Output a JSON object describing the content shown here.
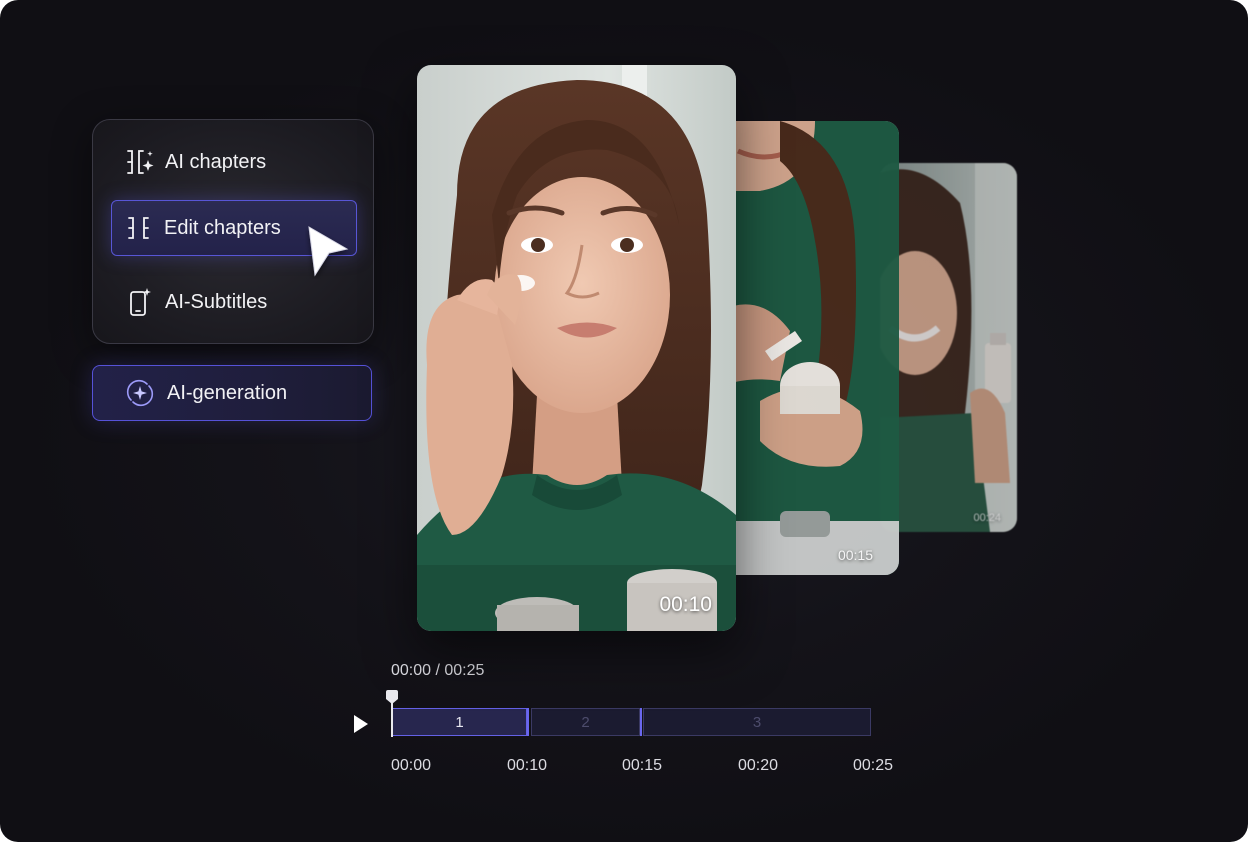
{
  "menu": {
    "items": [
      {
        "label": "AI chapters",
        "icon": "ai-chapters-icon"
      },
      {
        "label": "Edit chapters",
        "icon": "chapter-brackets-icon",
        "selected": true
      },
      {
        "label": "AI-Subtitles",
        "icon": "phone-sparkle-icon"
      }
    ]
  },
  "generation_button": {
    "label": "AI-generation",
    "icon": "sparkle-orbit-icon"
  },
  "cards": [
    {
      "timestamp": "00:10"
    },
    {
      "timestamp": "00:15"
    },
    {
      "timestamp": "00:24"
    }
  ],
  "timeline": {
    "readout": "00:00 / 00:25",
    "segments": [
      {
        "label": "1",
        "active": true
      },
      {
        "label": "2",
        "active": false
      },
      {
        "label": "3",
        "active": false
      }
    ],
    "tick_labels": [
      "00:00",
      "00:10",
      "00:15",
      "00:20",
      "00:25"
    ],
    "playhead_position": "00:00"
  },
  "colors": {
    "accent": "#5856d6",
    "background": "#141319",
    "sweater": "#1f5a44"
  }
}
